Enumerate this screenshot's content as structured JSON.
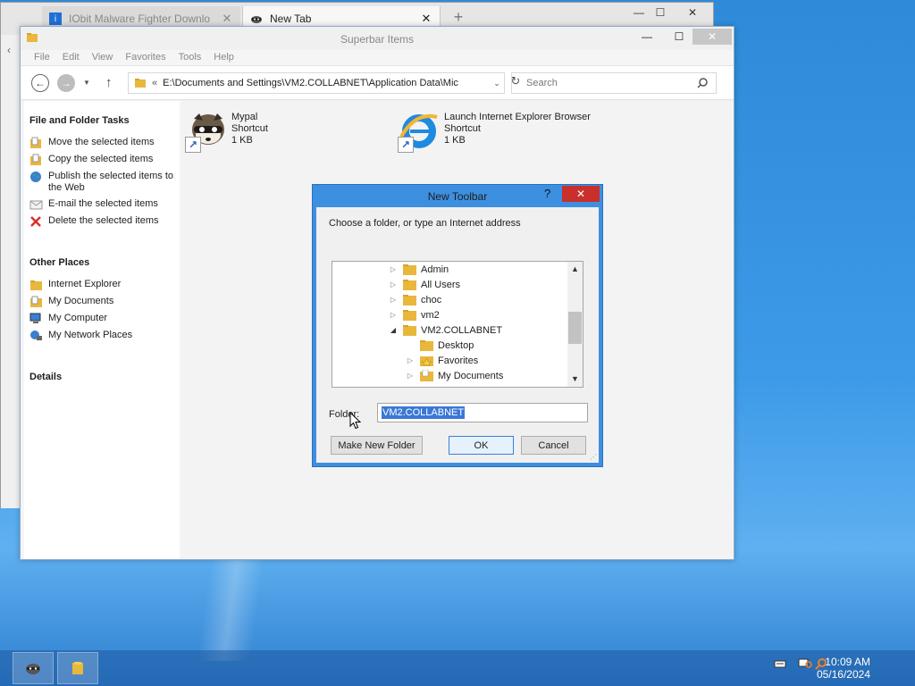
{
  "browser": {
    "tabs": [
      {
        "label": "IObit Malware Fighter Downlo",
        "icon": "iobit-icon",
        "active": false
      },
      {
        "label": "New Tab",
        "icon": "raccoon-icon",
        "active": true
      }
    ],
    "new_tab_symbol": "+"
  },
  "explorer": {
    "title": "Superbar Items",
    "menu": [
      "File",
      "Edit",
      "View",
      "Favorites",
      "Tools",
      "Help"
    ],
    "address": "E:\\Documents and Settings\\VM2.COLLABNET\\Application Data\\Mic",
    "search_placeholder": "Search",
    "left_pane": {
      "tasks_heading": "File and Folder Tasks",
      "tasks": [
        {
          "label": "Move the selected items",
          "icon": "move-icon"
        },
        {
          "label": "Copy the selected items",
          "icon": "copy-icon"
        },
        {
          "label": "Publish the selected items to the Web",
          "icon": "globe-icon"
        },
        {
          "label": "E-mail the selected items",
          "icon": "email-icon"
        },
        {
          "label": "Delete the selected items",
          "icon": "delete-icon"
        }
      ],
      "places_heading": "Other Places",
      "places": [
        {
          "label": "Internet Explorer",
          "icon": "folder-icon"
        },
        {
          "label": "My Documents",
          "icon": "documents-icon"
        },
        {
          "label": "My Computer",
          "icon": "computer-icon"
        },
        {
          "label": "My Network Places",
          "icon": "network-icon"
        }
      ],
      "details_heading": "Details"
    },
    "files": [
      {
        "name": "Mypal",
        "type": "Shortcut",
        "size": "1 KB",
        "icon": "raccoon-icon"
      },
      {
        "name": "Launch Internet Explorer Browser",
        "type": "Shortcut",
        "size": "1 KB",
        "icon": "internet-explorer-icon"
      }
    ]
  },
  "dialog": {
    "title": "New Toolbar",
    "help": "?",
    "prompt": "Choose a folder, or type an Internet address",
    "tree": [
      {
        "label": "Admin",
        "expanded": false
      },
      {
        "label": "All Users",
        "expanded": false
      },
      {
        "label": "choc",
        "expanded": false
      },
      {
        "label": "vm2",
        "expanded": false
      },
      {
        "label": "VM2.COLLABNET",
        "expanded": true
      },
      {
        "label": "Desktop",
        "expanded": null
      },
      {
        "label": "Favorites",
        "expanded": false
      },
      {
        "label": "My Documents",
        "expanded": false
      }
    ],
    "folder_label": "Folder:",
    "folder_value": "VM2.COLLABNET",
    "buttons": {
      "new_folder": "Make New Folder",
      "ok": "OK",
      "cancel": "Cancel"
    }
  },
  "taskbar": {
    "time": "10:09 AM",
    "date": "05/16/2024"
  },
  "colors": {
    "dialog_frame": "#3d8fe0",
    "close_red": "#c9302c",
    "selection": "#3a78d6",
    "folder": "#e8b73c"
  }
}
